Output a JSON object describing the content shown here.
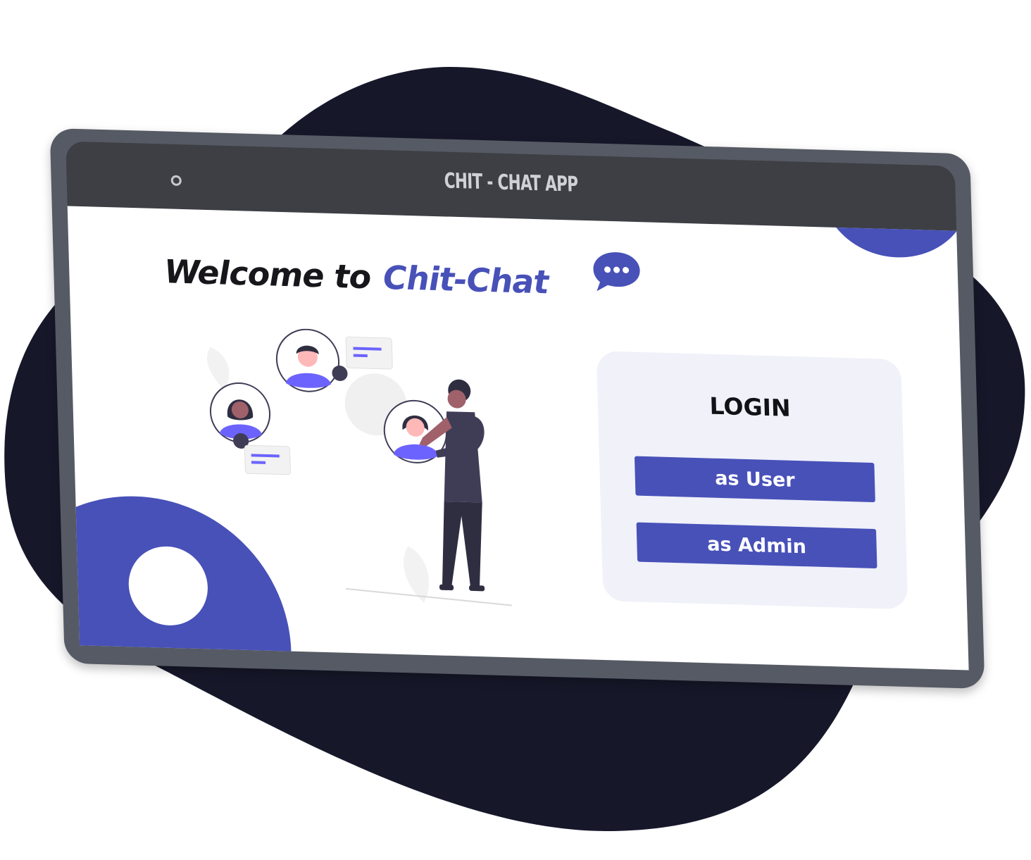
{
  "window": {
    "title": "CHIT - CHAT APP"
  },
  "welcome": {
    "prefix": "Welcome to",
    "brand": "Chit-Chat"
  },
  "login": {
    "title": "LOGIN",
    "user_button": "as User",
    "admin_button": "as Admin"
  },
  "colors": {
    "accent": "#4851b8",
    "backdrop": "#16182a",
    "frame": "#565a64",
    "titlebar": "#3d3f44",
    "card": "#f0f1f9"
  },
  "icons": {
    "chat_bubble": "chat-bubble-icon",
    "camera": "camera-dot-icon"
  }
}
